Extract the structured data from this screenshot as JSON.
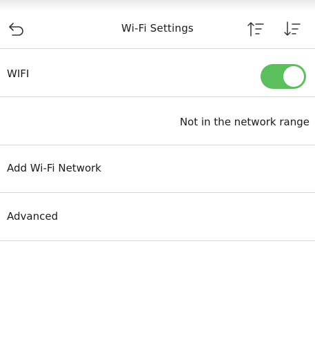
{
  "header": {
    "title": "Wi-Fi Settings",
    "back_icon": "back-arrow-icon",
    "sort_ascending_icon": "sort-ascending-icon",
    "sort_descending_icon": "sort-descending-icon"
  },
  "wifi": {
    "label": "WIFI",
    "toggle_on": true,
    "accent": "#5bbf5b"
  },
  "status": {
    "text": "Not in the network range"
  },
  "menu": {
    "add_network_label": "Add Wi-Fi Network",
    "advanced_label": "Advanced"
  }
}
